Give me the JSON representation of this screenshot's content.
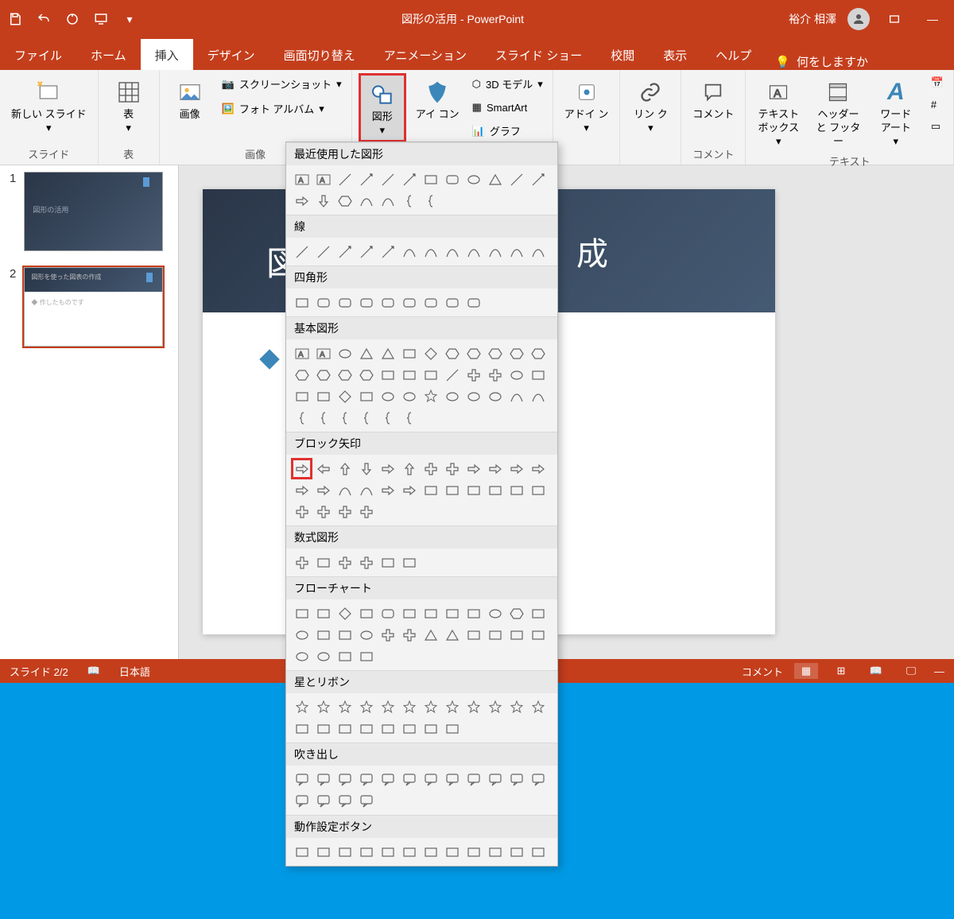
{
  "titlebar": {
    "title": "図形の活用 - PowerPoint",
    "user": "裕介 相澤"
  },
  "tabs": {
    "file": "ファイル",
    "home": "ホーム",
    "insert": "挿入",
    "design": "デザイン",
    "transitions": "画面切り替え",
    "animations": "アニメーション",
    "slideshow": "スライド ショー",
    "review": "校閲",
    "view": "表示",
    "help": "ヘルプ",
    "tellme": "何をしますか"
  },
  "ribbon": {
    "newSlide": "新しい\nスライド",
    "table": "表",
    "images": "画像",
    "screenshot": "スクリーンショット",
    "photoAlbum": "フォト アルバム",
    "shapes": "図形",
    "icons": "アイ\nコン",
    "models3d": "3D モデル",
    "smartart": "SmartArt",
    "chart": "グラフ",
    "addins": "アドイ\nン",
    "link": "リン\nク",
    "comment": "コメント",
    "textbox": "テキスト\nボックス",
    "headerFooter": "ヘッダーと\nフッター",
    "wordart": "ワード\nアート",
    "groups": {
      "slides": "スライド",
      "tables": "表",
      "images": "画像",
      "comments": "コメント",
      "text": "テキスト"
    }
  },
  "shapeCategories": {
    "recent": "最近使用した図形",
    "lines": "線",
    "rectangles": "四角形",
    "basic": "基本図形",
    "blockArrows": "ブロック矢印",
    "equation": "数式図形",
    "flowchart": "フローチャート",
    "stars": "星とリボン",
    "callouts": "吹き出し",
    "actionButtons": "動作設定ボタン"
  },
  "slide": {
    "titlePrefix": "図",
    "titleSuffix": "成",
    "thumb1Text": "図形の活用",
    "thumb2Title": "図形を使った図表の作成",
    "thumb2Body": "作したものです"
  },
  "statusbar": {
    "slideCount": "スライド 2/2",
    "language": "日本語",
    "comments": "コメント"
  },
  "thumbs": {
    "n1": "1",
    "n2": "2"
  }
}
